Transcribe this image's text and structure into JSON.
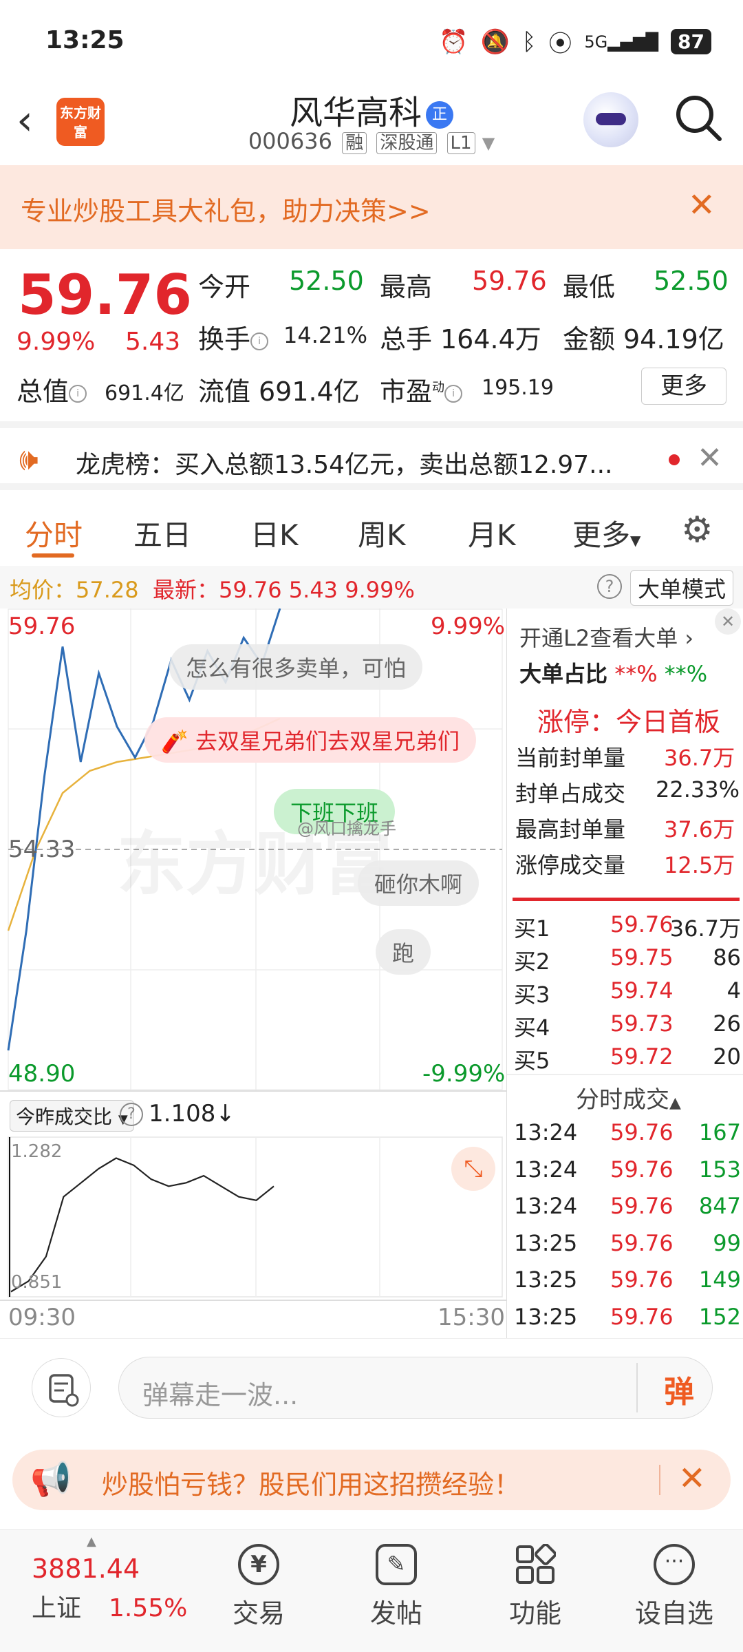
{
  "status": {
    "time": "13:25",
    "network": "5G",
    "battery": "87"
  },
  "header": {
    "logo_text": "东方财富",
    "stock_name": "风华高科",
    "badge": "正",
    "code": "000636",
    "tags": [
      "融",
      "深股通",
      "L1"
    ]
  },
  "promo": {
    "text": "专业炒股工具大礼包，助力决策>>"
  },
  "quote": {
    "price": "59.76",
    "change_pct": "9.99%",
    "change_amt": "5.43",
    "open_label": "今开",
    "open": "52.50",
    "high_label": "最高",
    "high": "59.76",
    "low_label": "最低",
    "low": "52.50",
    "turnover_label": "换手",
    "turnover": "14.21%",
    "volume_label": "总手",
    "volume": "164.4万",
    "amount_label": "金额",
    "amount": "94.19亿",
    "mktcap_label": "总值",
    "mktcap": "691.4亿",
    "float_label": "流值",
    "float": "691.4亿",
    "pe_label": "市盈",
    "pe_sup": "动",
    "pe": "195.19",
    "more": "更多"
  },
  "lhb": {
    "text": "龙虎榜：买入总额13.54亿元，卖出总额12.97..."
  },
  "tabs": [
    "分时",
    "五日",
    "日K",
    "周K",
    "月K",
    "更多"
  ],
  "avgbar": {
    "avg": "均价：57.28",
    "latest": "最新：59.76  5.43  9.99%",
    "big_mode": "大单模式"
  },
  "chart": {
    "y_top": "59.76",
    "y_mid": "54.33",
    "y_bottom": "48.90",
    "pct_top": "9.99%",
    "pct_bottom": "-9.99%",
    "watermark": "东方财富",
    "danmu": [
      "怎么有很多卖单，可怕",
      "去双星兄弟们去双星兄弟们",
      "下班下班",
      "砸你木啊",
      "跑"
    ],
    "weibo_watermark": "@风口擒龙手"
  },
  "chart_data": {
    "type": "line",
    "title": "",
    "xlabel": "",
    "ylabel": "",
    "x": [
      "09:30",
      "15:30"
    ],
    "ylim": [
      48.9,
      59.76
    ],
    "prev_close": 54.33,
    "series": [
      {
        "values": [
          49.8,
          52.5,
          56.0,
          58.9,
          56.3,
          58.3,
          57.1,
          56.4,
          57.2,
          58.6,
          57.7,
          58.8,
          58.1,
          59.1,
          58.5,
          59.76
        ]
      },
      {
        "values": [
          52.5,
          54.3,
          55.6,
          56.1,
          56.3,
          56.4,
          56.5,
          56.6,
          56.8,
          57.0,
          57.28
        ]
      }
    ]
  },
  "l2": {
    "title": "开通L2查看大单",
    "ratio_label": "大单占比",
    "ratio_buy": "**%",
    "ratio_sell": "**%",
    "limit_status": "涨停：今日首板",
    "seal_label": "当前封单量",
    "seal": "36.7万",
    "seal_ratio_label": "封单占成交",
    "seal_ratio": "22.33%",
    "max_seal_label": "最高封单量",
    "max_seal": "37.6万",
    "limit_vol_label": "涨停成交量",
    "limit_vol": "12.5万"
  },
  "orderbook": [
    {
      "label": "买1",
      "price": "59.76",
      "vol": "36.7万"
    },
    {
      "label": "买2",
      "price": "59.75",
      "vol": "86"
    },
    {
      "label": "买3",
      "price": "59.74",
      "vol": "4"
    },
    {
      "label": "买4",
      "price": "59.73",
      "vol": "26"
    },
    {
      "label": "买5",
      "price": "59.72",
      "vol": "20"
    }
  ],
  "trades_title": "分时成交",
  "trades": [
    {
      "time": "13:24",
      "price": "59.76",
      "vol": "167"
    },
    {
      "time": "13:24",
      "price": "59.76",
      "vol": "153"
    },
    {
      "time": "13:24",
      "price": "59.76",
      "vol": "847"
    },
    {
      "time": "13:25",
      "price": "59.76",
      "vol": "99"
    },
    {
      "time": "13:25",
      "price": "59.76",
      "vol": "149"
    },
    {
      "time": "13:25",
      "price": "59.76",
      "vol": "152"
    }
  ],
  "volume": {
    "dropdown": "今昨成交比",
    "ratio": "1.108↓",
    "y_top": "1.282",
    "y_bottom": "0.851",
    "x_start": "09:30",
    "x_end": "15:30"
  },
  "input": {
    "placeholder": "弹幕走一波...",
    "send": "弹"
  },
  "banner2": {
    "text": "炒股怕亏钱？股民们用这招攒经验！"
  },
  "nav": {
    "index_value": "3881.44",
    "index_name": "上证",
    "index_pct": "1.55%",
    "items": [
      "交易",
      "发帖",
      "功能",
      "设自选"
    ]
  }
}
